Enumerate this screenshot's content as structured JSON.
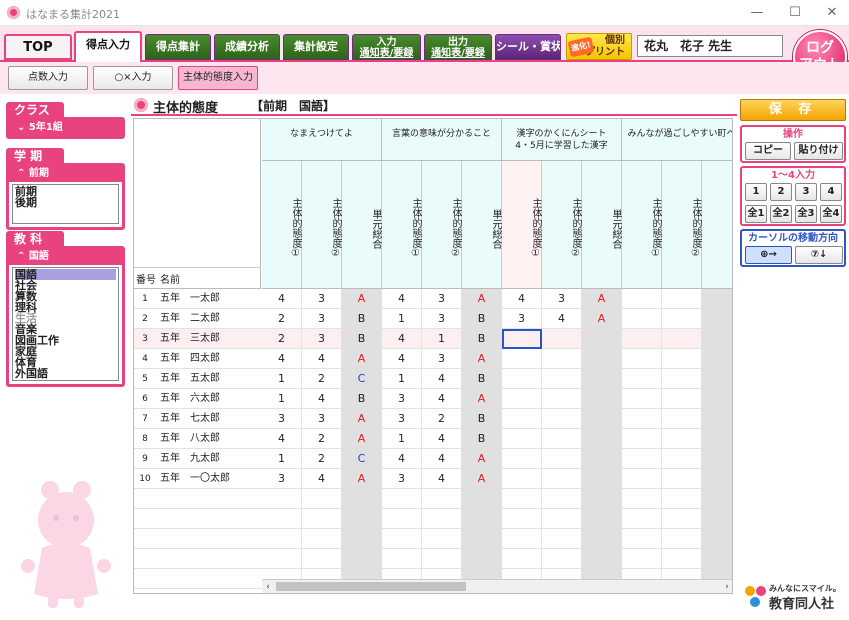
{
  "window": {
    "title": "はなまる集計2021",
    "minimize": "—",
    "maximize": "☐",
    "close": "✕"
  },
  "tabs": [
    {
      "label": "TOP"
    },
    {
      "label": "得点入力"
    },
    {
      "label": "得点集計"
    },
    {
      "label": "成績分析"
    },
    {
      "label": "集計設定"
    },
    {
      "line1": "入力",
      "line2": "通知表/要録"
    },
    {
      "line1": "出力",
      "line2": "通知表/要録"
    },
    {
      "label": "シール・賞状"
    }
  ],
  "kobetsu": {
    "badge": "進化!",
    "line1": "個別",
    "line2": "プリント"
  },
  "teacher_name": "花丸　花子 先生",
  "logout": {
    "line1": "ログ",
    "line2": "アウト"
  },
  "subtabs": [
    "点数入力",
    "○×入力",
    "主体的態度入力"
  ],
  "sidebar": {
    "class": {
      "label": "クラス",
      "selected": "5年1組"
    },
    "term": {
      "label": "学 期",
      "selected": "前期",
      "items": [
        "前期",
        "後期"
      ]
    },
    "subject": {
      "label": "教 科",
      "selected": "国語",
      "items": [
        "国語",
        "社会",
        "算数",
        "理科",
        "生活",
        "音楽",
        "図画工作",
        "家庭",
        "体育",
        "外国語"
      ]
    }
  },
  "content": {
    "title": "主体的態度",
    "subtitle": "【前期　国語】"
  },
  "grid": {
    "no_header": "番号",
    "name_header": "名前",
    "groups": [
      {
        "line1": "なまえつけてよ",
        "line2": ""
      },
      {
        "line1": "言葉の意味が分かること",
        "line2": ""
      },
      {
        "line1": "漢字のかくにんシート",
        "line2": "4・5月に学習した漢字"
      },
      {
        "line1": "みんなが過ごしやすい町へ",
        "line2": ""
      }
    ],
    "col_labels": [
      "主体的態度①",
      "主体的態度②",
      "単元総合"
    ],
    "rows": [
      {
        "no": "1",
        "name": "五年　一太郎",
        "vals": [
          "4",
          "3",
          "A",
          "4",
          "3",
          "A",
          "4",
          "3",
          "A",
          "",
          "",
          ""
        ]
      },
      {
        "no": "2",
        "name": "五年　二太郎",
        "vals": [
          "2",
          "3",
          "B",
          "1",
          "3",
          "B",
          "3",
          "4",
          "A",
          "",
          "",
          ""
        ]
      },
      {
        "no": "3",
        "name": "五年　三太郎",
        "vals": [
          "2",
          "3",
          "B",
          "4",
          "1",
          "B",
          "",
          "",
          "",
          "",
          "",
          ""
        ]
      },
      {
        "no": "4",
        "name": "五年　四太郎",
        "vals": [
          "4",
          "4",
          "A",
          "4",
          "3",
          "A",
          "",
          "",
          "",
          "",
          "",
          ""
        ]
      },
      {
        "no": "5",
        "name": "五年　五太郎",
        "vals": [
          "1",
          "2",
          "C",
          "1",
          "4",
          "B",
          "",
          "",
          "",
          "",
          "",
          ""
        ]
      },
      {
        "no": "6",
        "name": "五年　六太郎",
        "vals": [
          "1",
          "4",
          "B",
          "3",
          "4",
          "A",
          "",
          "",
          "",
          "",
          "",
          ""
        ]
      },
      {
        "no": "7",
        "name": "五年　七太郎",
        "vals": [
          "3",
          "3",
          "A",
          "3",
          "2",
          "B",
          "",
          "",
          "",
          "",
          "",
          ""
        ]
      },
      {
        "no": "8",
        "name": "五年　八太郎",
        "vals": [
          "4",
          "2",
          "A",
          "1",
          "4",
          "B",
          "",
          "",
          "",
          "",
          "",
          ""
        ]
      },
      {
        "no": "9",
        "name": "五年　九太郎",
        "vals": [
          "1",
          "2",
          "C",
          "4",
          "4",
          "A",
          "",
          "",
          "",
          "",
          "",
          ""
        ]
      },
      {
        "no": "10",
        "name": "五年　一〇太郎",
        "vals": [
          "3",
          "4",
          "A",
          "3",
          "4",
          "A",
          "",
          "",
          "",
          "",
          "",
          ""
        ]
      }
    ],
    "active_column": 6,
    "cursor_row": 2,
    "highlight_row": 2
  },
  "right": {
    "save": "保 存",
    "ops": {
      "label": "操作",
      "copy": "コピー",
      "paste": "貼り付け"
    },
    "input": {
      "label": "1〜4入力",
      "nums": [
        "1",
        "2",
        "3",
        "4"
      ],
      "all": [
        "全1",
        "全2",
        "全3",
        "全4"
      ]
    },
    "cursor": {
      "label": "カーソルの移動方向",
      "right": "⊕→",
      "down": "⑦↓"
    }
  },
  "logo": {
    "tagline": "みんなにスマイル。",
    "name": "教育同人社"
  },
  "colors": {
    "accent": "#e8437e",
    "tab_green": "#3a7a24",
    "tab_purple": "#6b2f8c",
    "cursor_blue": "#2456c8"
  }
}
